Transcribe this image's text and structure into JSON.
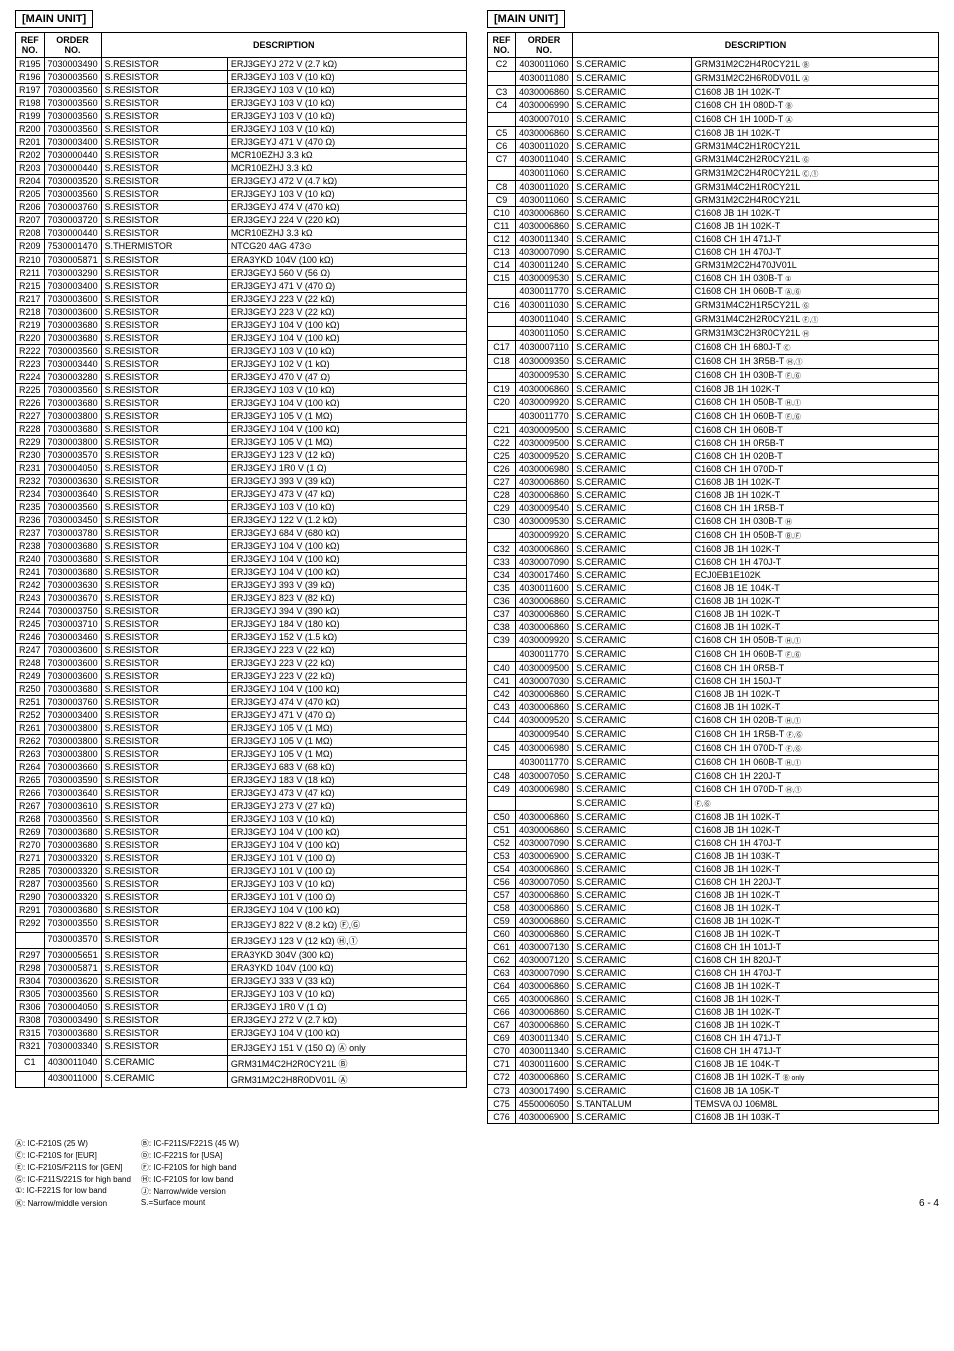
{
  "leftTable": {
    "title": "[MAIN UNIT]",
    "headers": [
      "REF\nNO.",
      "ORDER\nNO.",
      "DESCRIPTION"
    ],
    "rows": [
      [
        "R195",
        "7030003490",
        "S.RESISTOR",
        "ERJ3GEYJ 272 V (2.7 kΩ)"
      ],
      [
        "R196",
        "7030003560",
        "S.RESISTOR",
        "ERJ3GEYJ 103 V (10 kΩ)"
      ],
      [
        "R197",
        "7030003560",
        "S.RESISTOR",
        "ERJ3GEYJ 103 V (10 kΩ)"
      ],
      [
        "R198",
        "7030003560",
        "S.RESISTOR",
        "ERJ3GEYJ 103 V (10 kΩ)"
      ],
      [
        "R199",
        "7030003560",
        "S.RESISTOR",
        "ERJ3GEYJ 103 V (10 kΩ)"
      ],
      [
        "R200",
        "7030003560",
        "S.RESISTOR",
        "ERJ3GEYJ 103 V (10 kΩ)"
      ],
      [
        "R201",
        "7030003400",
        "S.RESISTOR",
        "ERJ3GEYJ 471 V (470 Ω)"
      ],
      [
        "R202",
        "7030000440",
        "S.RESISTOR",
        "MCR10EZHJ 3.3 kΩ"
      ],
      [
        "R203",
        "7030000440",
        "S.RESISTOR",
        "MCR10EZHJ 3.3 kΩ"
      ],
      [
        "R204",
        "7030003520",
        "S.RESISTOR",
        "ERJ3GEYJ 472 V (4.7 kΩ)"
      ],
      [
        "R205",
        "7030003560",
        "S.RESISTOR",
        "ERJ3GEYJ 103 V (10 kΩ)"
      ],
      [
        "R206",
        "7030003760",
        "S.RESISTOR",
        "ERJ3GEYJ 474 V (470 kΩ)"
      ],
      [
        "R207",
        "7030003720",
        "S.RESISTOR",
        "ERJ3GEYJ 224 V (220 kΩ)"
      ],
      [
        "R208",
        "7030000440",
        "S.RESISTOR",
        "MCR10EZHJ 3.3 kΩ"
      ],
      [
        "R209",
        "7530001470",
        "S.THERMISTOR",
        "NTCG20 4AG 473⊙"
      ],
      [
        "R210",
        "7030005871",
        "S.RESISTOR",
        "ERA3YKD 104V (100 kΩ)"
      ],
      [
        "R211",
        "7030003290",
        "S.RESISTOR",
        "ERJ3GEYJ 560 V (56 Ω)"
      ],
      [
        "R215",
        "7030003400",
        "S.RESISTOR",
        "ERJ3GEYJ 471 V (470 Ω)"
      ],
      [
        "R217",
        "7030003600",
        "S.RESISTOR",
        "ERJ3GEYJ 223 V (22 kΩ)"
      ],
      [
        "R218",
        "7030003600",
        "S.RESISTOR",
        "ERJ3GEYJ 223 V (22 kΩ)"
      ],
      [
        "R219",
        "7030003680",
        "S.RESISTOR",
        "ERJ3GEYJ 104 V (100 kΩ)"
      ],
      [
        "R220",
        "7030003680",
        "S.RESISTOR",
        "ERJ3GEYJ 104 V (100 kΩ)"
      ],
      [
        "R222",
        "7030003560",
        "S.RESISTOR",
        "ERJ3GEYJ 103 V (10 kΩ)"
      ],
      [
        "R223",
        "7030003440",
        "S.RESISTOR",
        "ERJ3GEYJ 102 V (1 kΩ)"
      ],
      [
        "R224",
        "7030003280",
        "S.RESISTOR",
        "ERJ3GEYJ 470 V (47 Ω)"
      ],
      [
        "R225",
        "7030003560",
        "S.RESISTOR",
        "ERJ3GEYJ 103 V (10 kΩ)"
      ],
      [
        "R226",
        "7030003680",
        "S.RESISTOR",
        "ERJ3GEYJ 104 V (100 kΩ)"
      ],
      [
        "R227",
        "7030003800",
        "S.RESISTOR",
        "ERJ3GEYJ 105 V (1 MΩ)"
      ],
      [
        "R228",
        "7030003680",
        "S.RESISTOR",
        "ERJ3GEYJ 104 V (100 kΩ)"
      ],
      [
        "R229",
        "7030003800",
        "S.RESISTOR",
        "ERJ3GEYJ 105 V (1 MΩ)"
      ],
      [
        "R230",
        "7030003570",
        "S.RESISTOR",
        "ERJ3GEYJ 123 V (12 kΩ)"
      ],
      [
        "R231",
        "7030004050",
        "S.RESISTOR",
        "ERJ3GEYJ 1R0 V (1 Ω)"
      ],
      [
        "R232",
        "7030003630",
        "S.RESISTOR",
        "ERJ3GEYJ 393 V (39 kΩ)"
      ],
      [
        "R234",
        "7030003640",
        "S.RESISTOR",
        "ERJ3GEYJ 473 V (47 kΩ)"
      ],
      [
        "R235",
        "7030003560",
        "S.RESISTOR",
        "ERJ3GEYJ 103 V (10 kΩ)"
      ],
      [
        "R236",
        "7030003450",
        "S.RESISTOR",
        "ERJ3GEYJ 122 V (1.2 kΩ)"
      ],
      [
        "R237",
        "7030003780",
        "S.RESISTOR",
        "ERJ3GEYJ 684 V (680 kΩ)"
      ],
      [
        "R238",
        "7030003680",
        "S.RESISTOR",
        "ERJ3GEYJ 104 V (100 kΩ)"
      ],
      [
        "R240",
        "7030003680",
        "S.RESISTOR",
        "ERJ3GEYJ 104 V (100 kΩ)"
      ],
      [
        "R241",
        "7030003680",
        "S.RESISTOR",
        "ERJ3GEYJ 104 V (100 kΩ)"
      ],
      [
        "R242",
        "7030003630",
        "S.RESISTOR",
        "ERJ3GEYJ 393 V (39 kΩ)"
      ],
      [
        "R243",
        "7030003670",
        "S.RESISTOR",
        "ERJ3GEYJ 823 V (82 kΩ)"
      ],
      [
        "R244",
        "7030003750",
        "S.RESISTOR",
        "ERJ3GEYJ 394 V (390 kΩ)"
      ],
      [
        "R245",
        "7030003710",
        "S.RESISTOR",
        "ERJ3GEYJ 184 V (180 kΩ)"
      ],
      [
        "R246",
        "7030003460",
        "S.RESISTOR",
        "ERJ3GEYJ 152 V (1.5 kΩ)"
      ],
      [
        "R247",
        "7030003600",
        "S.RESISTOR",
        "ERJ3GEYJ 223 V (22 kΩ)"
      ],
      [
        "R248",
        "7030003600",
        "S.RESISTOR",
        "ERJ3GEYJ 223 V (22 kΩ)"
      ],
      [
        "R249",
        "7030003600",
        "S.RESISTOR",
        "ERJ3GEYJ 223 V (22 kΩ)"
      ],
      [
        "R250",
        "7030003680",
        "S.RESISTOR",
        "ERJ3GEYJ 104 V (100 kΩ)"
      ],
      [
        "R251",
        "7030003760",
        "S.RESISTOR",
        "ERJ3GEYJ 474 V (470 kΩ)"
      ],
      [
        "R252",
        "7030003400",
        "S.RESISTOR",
        "ERJ3GEYJ 471 V (470 Ω)"
      ],
      [
        "R261",
        "7030003800",
        "S.RESISTOR",
        "ERJ3GEYJ 105 V (1 MΩ)"
      ],
      [
        "R262",
        "7030003800",
        "S.RESISTOR",
        "ERJ3GEYJ 105 V (1 MΩ)"
      ],
      [
        "R263",
        "7030003800",
        "S.RESISTOR",
        "ERJ3GEYJ 105 V (1 MΩ)"
      ],
      [
        "R264",
        "7030003660",
        "S.RESISTOR",
        "ERJ3GEYJ 683 V (68 kΩ)"
      ],
      [
        "R265",
        "7030003590",
        "S.RESISTOR",
        "ERJ3GEYJ 183 V (18 kΩ)"
      ],
      [
        "R266",
        "7030003640",
        "S.RESISTOR",
        "ERJ3GEYJ 473 V (47 kΩ)"
      ],
      [
        "R267",
        "7030003610",
        "S.RESISTOR",
        "ERJ3GEYJ 273 V (27 kΩ)"
      ],
      [
        "R268",
        "7030003560",
        "S.RESISTOR",
        "ERJ3GEYJ 103 V (10 kΩ)"
      ],
      [
        "R269",
        "7030003680",
        "S.RESISTOR",
        "ERJ3GEYJ 104 V (100 kΩ)"
      ],
      [
        "R270",
        "7030003680",
        "S.RESISTOR",
        "ERJ3GEYJ 104 V (100 kΩ)"
      ],
      [
        "R271",
        "7030003320",
        "S.RESISTOR",
        "ERJ3GEYJ 101 V (100 Ω)"
      ],
      [
        "R285",
        "7030003320",
        "S.RESISTOR",
        "ERJ3GEYJ 101 V (100 Ω)"
      ],
      [
        "R287",
        "7030003560",
        "S.RESISTOR",
        "ERJ3GEYJ 103 V (10 kΩ)"
      ],
      [
        "R290",
        "7030003320",
        "S.RESISTOR",
        "ERJ3GEYJ 101 V (100 Ω)"
      ],
      [
        "R291",
        "7030003680",
        "S.RESISTOR",
        "ERJ3GEYJ 104 V (100 kΩ)"
      ],
      [
        "R292",
        "7030003550",
        "S.RESISTOR",
        "ERJ3GEYJ 822 V (8.2 kΩ) Ⓕ,Ⓖ"
      ],
      [
        "",
        "7030003570",
        "S.RESISTOR",
        "ERJ3GEYJ 123 V (12 kΩ) Ⓗ,①"
      ],
      [
        "R297",
        "7030005651",
        "S.RESISTOR",
        "ERA3YKD 304V (300 kΩ)"
      ],
      [
        "R298",
        "7030005871",
        "S.RESISTOR",
        "ERA3YKD 104V (100 kΩ)"
      ],
      [
        "R304",
        "7030003620",
        "S.RESISTOR",
        "ERJ3GEYJ 333 V (33 kΩ)"
      ],
      [
        "R305",
        "7030003560",
        "S.RESISTOR",
        "ERJ3GEYJ 103 V (10 kΩ)"
      ],
      [
        "R306",
        "7030004050",
        "S.RESISTOR",
        "ERJ3GEYJ 1R0 V (1 Ω)"
      ],
      [
        "R308",
        "7030003490",
        "S.RESISTOR",
        "ERJ3GEYJ 272 V (2.7 kΩ)"
      ],
      [
        "R315",
        "7030003680",
        "S.RESISTOR",
        "ERJ3GEYJ 104 V (100 kΩ)"
      ],
      [
        "R321",
        "7030003340",
        "S.RESISTOR",
        "ERJ3GEYJ 151 V (150 Ω) Ⓐ only"
      ]
    ],
    "ceramicRows": [
      [
        "C1",
        "4030011040",
        "S.CERAMIC",
        "GRM31M4C2H2R0CY21L",
        "Ⓑ"
      ],
      [
        "",
        "4030011000",
        "S.CERAMIC",
        "GRM31M2C2H8R0DV01L",
        "Ⓐ"
      ]
    ]
  },
  "rightTable": {
    "title": "[MAIN UNIT]",
    "headers": [
      "REF\nNO.",
      "ORDER\nNO.",
      "DESCRIPTION"
    ],
    "rows": [
      [
        "C2",
        "4030011060",
        "S.CERAMIC",
        "GRM31M2C2H4R0CY21L",
        "Ⓑ"
      ],
      [
        "",
        "4030011080",
        "S.CERAMIC",
        "GRM31M2C2H6R0DV01L",
        "Ⓐ"
      ],
      [
        "C3",
        "4030006860",
        "S.CERAMIC",
        "C1608 JB 1H 102K-T",
        ""
      ],
      [
        "C4",
        "4030006990",
        "S.CERAMIC",
        "C1608 CH 1H 080D-T",
        "Ⓑ"
      ],
      [
        "",
        "4030007010",
        "S.CERAMIC",
        "C1608 CH 1H 100D-T",
        "Ⓐ"
      ],
      [
        "C5",
        "4030006860",
        "S.CERAMIC",
        "C1608 JB 1H 102K-T",
        ""
      ],
      [
        "C6",
        "4030011020",
        "S.CERAMIC",
        "GRM31M4C2H1R0CY21L",
        ""
      ],
      [
        "C7",
        "4030011040",
        "S.CERAMIC",
        "GRM31M4C2H2R0CY21L",
        "Ⓖ"
      ],
      [
        "",
        "4030011060",
        "S.CERAMIC",
        "GRM31M2C2H4R0CY21L",
        "Ⓒ,①"
      ],
      [
        "C8",
        "4030011020",
        "S.CERAMIC",
        "GRM31M4C2H1R0CY21L",
        ""
      ],
      [
        "C9",
        "4030011060",
        "S.CERAMIC",
        "GRM31M2C2H4R0CY21L",
        ""
      ],
      [
        "C10",
        "4030006860",
        "S.CERAMIC",
        "C1608 JB 1H 102K-T",
        ""
      ],
      [
        "C11",
        "4030006860",
        "S.CERAMIC",
        "C1608 JB 1H 102K-T",
        ""
      ],
      [
        "C12",
        "4030011340",
        "S.CERAMIC",
        "C1608 CH 1H 471J-T",
        ""
      ],
      [
        "C13",
        "4030007090",
        "S.CERAMIC",
        "C1608 CH 1H 470J-T",
        ""
      ],
      [
        "C14",
        "4030011240",
        "S.CERAMIC",
        "GRM31M2C2H470JV01L",
        ""
      ],
      [
        "C15",
        "4030009530",
        "S.CERAMIC",
        "C1608 CH 1H 030B-T",
        "①"
      ],
      [
        "",
        "4030011770",
        "S.CERAMIC",
        "C1608 CH 1H 060B-T",
        "Ⓐ,Ⓖ"
      ],
      [
        "C16",
        "4030011030",
        "S.CERAMIC",
        "GRM31M4C2H1R5CY21L",
        "Ⓖ"
      ],
      [
        "",
        "4030011040",
        "S.CERAMIC",
        "GRM31M4C2H2R0CY21L",
        "Ⓕ,①"
      ],
      [
        "",
        "4030011050",
        "S.CERAMIC",
        "GRM31M3C2H3R0CY21L",
        "Ⓗ"
      ],
      [
        "C17",
        "4030007110",
        "S.CERAMIC",
        "C1608 CH 1H 680J-T",
        "Ⓒ"
      ],
      [
        "C18",
        "4030009350",
        "S.CERAMIC",
        "C1608 CH 1H 3R5B-T",
        "Ⓗ,①"
      ],
      [
        "",
        "4030009530",
        "S.CERAMIC",
        "C1608 CH 1H 030B-T",
        "Ⓕ,Ⓖ"
      ],
      [
        "C19",
        "4030006860",
        "S.CERAMIC",
        "C1608 JB 1H 102K-T",
        ""
      ],
      [
        "C20",
        "4030009920",
        "S.CERAMIC",
        "C1608 CH 1H 050B-T",
        "Ⓗ,①"
      ],
      [
        "",
        "4030011770",
        "S.CERAMIC",
        "C1608 CH 1H 060B-T",
        "Ⓕ,Ⓖ"
      ],
      [
        "C21",
        "4030009500",
        "S.CERAMIC",
        "C1608 CH 1H 060B-T",
        ""
      ],
      [
        "C22",
        "4030009500",
        "S.CERAMIC",
        "C1608 CH 1H 0R5B-T",
        ""
      ],
      [
        "C25",
        "4030009520",
        "S.CERAMIC",
        "C1608 CH 1H 020B-T",
        ""
      ],
      [
        "C26",
        "4030006980",
        "S.CERAMIC",
        "C1608 CH 1H 070D-T",
        ""
      ],
      [
        "C27",
        "4030006860",
        "S.CERAMIC",
        "C1608 JB 1H 102K-T",
        ""
      ],
      [
        "C28",
        "4030006860",
        "S.CERAMIC",
        "C1608 JB 1H 102K-T",
        ""
      ],
      [
        "C29",
        "4030009540",
        "S.CERAMIC",
        "C1608 CH 1H 1R5B-T",
        ""
      ],
      [
        "C30",
        "4030009530",
        "S.CERAMIC",
        "C1608 CH 1H 030B-T",
        "Ⓗ"
      ],
      [
        "",
        "4030009920",
        "S.CERAMIC",
        "C1608 CH 1H 050B-T",
        "Ⓑ,Ⓕ"
      ],
      [
        "C32",
        "4030006860",
        "S.CERAMIC",
        "C1608 JB 1H 102K-T",
        ""
      ],
      [
        "C33",
        "4030007090",
        "S.CERAMIC",
        "C1608 CH 1H 470J-T",
        ""
      ],
      [
        "C34",
        "4030017460",
        "S.CERAMIC",
        "ECJ0EB1E102K",
        ""
      ],
      [
        "C35",
        "4030011600",
        "S.CERAMIC",
        "C1608 JB 1E 104K-T",
        ""
      ],
      [
        "C36",
        "4030006860",
        "S.CERAMIC",
        "C1608 JB 1H 102K-T",
        ""
      ],
      [
        "C37",
        "4030006860",
        "S.CERAMIC",
        "C1608 JB 1H 102K-T",
        ""
      ],
      [
        "C38",
        "4030006860",
        "S.CERAMIC",
        "C1608 JB 1H 102K-T",
        ""
      ],
      [
        "C39",
        "4030009920",
        "S.CERAMIC",
        "C1608 CH 1H 050B-T",
        "Ⓗ,①"
      ],
      [
        "",
        "4030011770",
        "S.CERAMIC",
        "C1608 CH 1H 060B-T",
        "Ⓕ,Ⓖ"
      ],
      [
        "C40",
        "4030009500",
        "S.CERAMIC",
        "C1608 CH 1H 0R5B-T",
        ""
      ],
      [
        "C41",
        "4030007030",
        "S.CERAMIC",
        "C1608 CH 1H 150J-T",
        ""
      ],
      [
        "C42",
        "4030006860",
        "S.CERAMIC",
        "C1608 JB 1H 102K-T",
        ""
      ],
      [
        "C43",
        "4030006860",
        "S.CERAMIC",
        "C1608 JB 1H 102K-T",
        ""
      ],
      [
        "C44",
        "4030009520",
        "S.CERAMIC",
        "C1608 CH 1H 020B-T",
        "Ⓗ,①"
      ],
      [
        "",
        "4030009540",
        "S.CERAMIC",
        "C1608 CH 1H 1R5B-T",
        "Ⓕ,Ⓖ"
      ],
      [
        "C45",
        "4030006980",
        "S.CERAMIC",
        "C1608 CH 1H 070D-T",
        "Ⓕ,Ⓖ"
      ],
      [
        "",
        "4030011770",
        "S.CERAMIC",
        "C1608 CH 1H 060B-T",
        "Ⓗ,①"
      ],
      [
        "C48",
        "4030007050",
        "S.CERAMIC",
        "C1608 CH 1H 220J-T",
        ""
      ],
      [
        "C49",
        "4030006980",
        "S.CERAMIC",
        "C1608 CH 1H 070D-T",
        "Ⓗ,①"
      ],
      [
        "",
        "",
        "S.CERAMIC",
        "",
        "Ⓕ,Ⓖ"
      ],
      [
        "C50",
        "4030006860",
        "S.CERAMIC",
        "C1608 JB 1H 102K-T",
        ""
      ],
      [
        "C51",
        "4030006860",
        "S.CERAMIC",
        "C1608 JB 1H 102K-T",
        ""
      ],
      [
        "C52",
        "4030007090",
        "S.CERAMIC",
        "C1608 CH 1H 470J-T",
        ""
      ],
      [
        "C53",
        "4030006900",
        "S.CERAMIC",
        "C1608 JB 1H 103K-T",
        ""
      ],
      [
        "C54",
        "4030006860",
        "S.CERAMIC",
        "C1608 JB 1H 102K-T",
        ""
      ],
      [
        "C56",
        "4030007050",
        "S.CERAMIC",
        "C1608 CH 1H 220J-T",
        ""
      ],
      [
        "C57",
        "4030006860",
        "S.CERAMIC",
        "C1608 JB 1H 102K-T",
        ""
      ],
      [
        "C58",
        "4030006860",
        "S.CERAMIC",
        "C1608 JB 1H 102K-T",
        ""
      ],
      [
        "C59",
        "4030006860",
        "S.CERAMIC",
        "C1608 JB 1H 102K-T",
        ""
      ],
      [
        "C60",
        "4030006860",
        "S.CERAMIC",
        "C1608 JB 1H 102K-T",
        ""
      ],
      [
        "C61",
        "4030007130",
        "S.CERAMIC",
        "C1608 CH 1H 101J-T",
        ""
      ],
      [
        "C62",
        "4030007120",
        "S.CERAMIC",
        "C1608 CH 1H 820J-T",
        ""
      ],
      [
        "C63",
        "4030007090",
        "S.CERAMIC",
        "C1608 CH 1H 470J-T",
        ""
      ],
      [
        "C64",
        "4030006860",
        "S.CERAMIC",
        "C1608 JB 1H 102K-T",
        ""
      ],
      [
        "C65",
        "4030006860",
        "S.CERAMIC",
        "C1608 JB 1H 102K-T",
        ""
      ],
      [
        "C66",
        "4030006860",
        "S.CERAMIC",
        "C1608 JB 1H 102K-T",
        ""
      ],
      [
        "C67",
        "4030006860",
        "S.CERAMIC",
        "C1608 JB 1H 102K-T",
        ""
      ],
      [
        "C69",
        "4030011340",
        "S.CERAMIC",
        "C1608 CH 1H 471J-T",
        ""
      ],
      [
        "C70",
        "4030011340",
        "S.CERAMIC",
        "C1608 CH 1H 471J-T",
        ""
      ],
      [
        "C71",
        "4030011600",
        "S.CERAMIC",
        "C1608 JB 1E 104K-T",
        ""
      ],
      [
        "C72",
        "4030006860",
        "S.CERAMIC",
        "C1608 JB 1H 102K-T",
        "Ⓑ only"
      ],
      [
        "C73",
        "4030017490",
        "S.CERAMIC",
        "C1608 JB 1A 105K-T",
        ""
      ],
      [
        "C75",
        "4550006050",
        "S.TANTALUM",
        "TEMSVA 0J 106M8L",
        ""
      ],
      [
        "C76",
        "4030006900",
        "S.CERAMIC",
        "C1608 JB 1H 103K-T",
        ""
      ]
    ]
  },
  "footer": {
    "notes": [
      {
        "label": "Ⓐ: IC-F210S (25 W)",
        "sep": "Ⓑ: IC-F211S/F221S (45 W)"
      },
      {
        "label": "①: IC-F221S for low band",
        "sep": ""
      },
      {
        "label": "Ⓒ: IC-F210S for [EUR]",
        "sep": "Ⓓ: IC-F221S for [USA]"
      },
      {
        "label": "Ⓙ: Narrow/wide version",
        "sep": ""
      },
      {
        "label": "Ⓔ: IC-F210S/F211S for [GEN]",
        "sep": "Ⓕ: IC-F210S for high band"
      },
      {
        "label": "Ⓚ: Narrow/middle version",
        "sep": ""
      },
      {
        "label": "Ⓖ: IC-F211S/221S for high band",
        "sep": "Ⓗ: IC-F210S for low band"
      },
      {
        "label": "S.=Surface mount",
        "sep": ""
      }
    ],
    "pageNum": "6 - 4"
  }
}
